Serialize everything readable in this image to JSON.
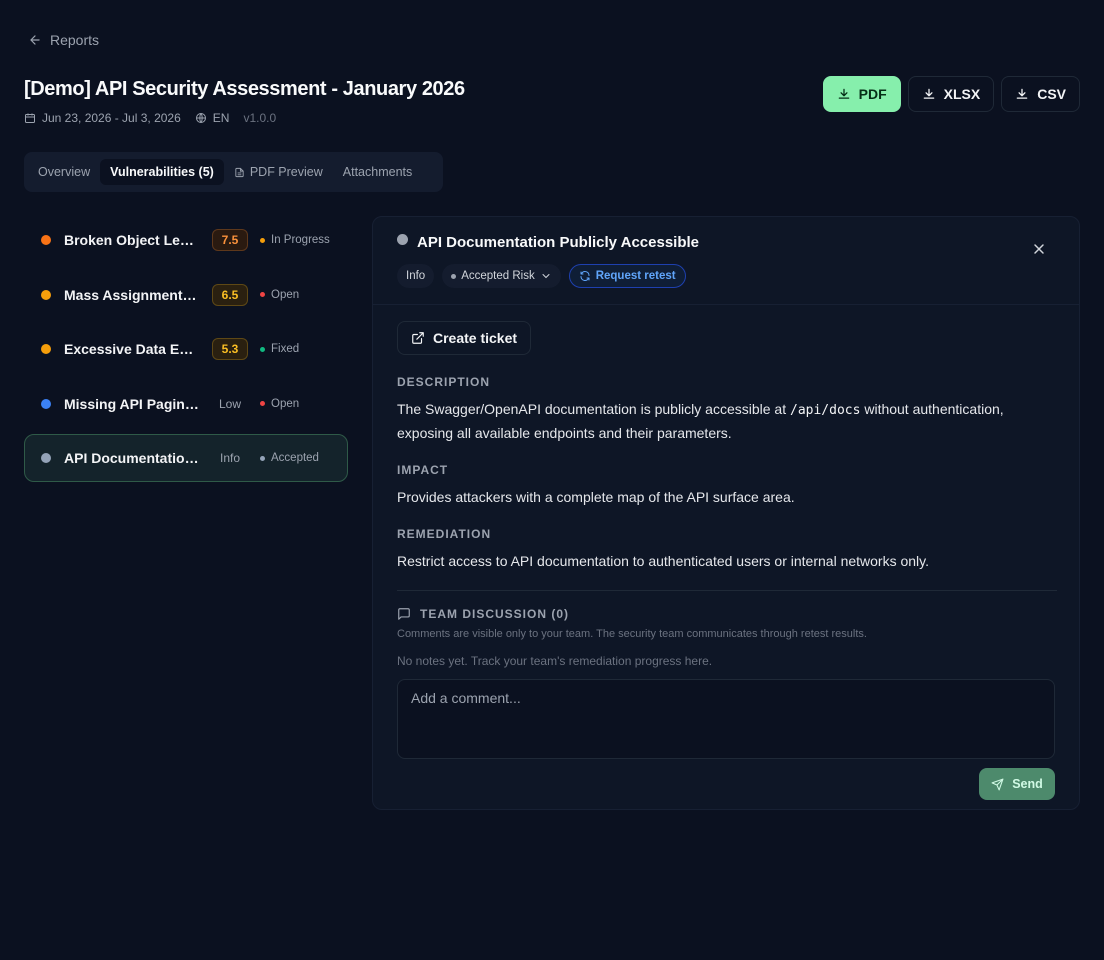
{
  "nav": {
    "back_label": "Reports"
  },
  "report": {
    "title": "[Demo] API Security Assessment - January 2026",
    "date_range": "Jun 23, 2026 - Jul 3, 2026",
    "language": "EN",
    "version": "v1.0.0"
  },
  "exports": [
    {
      "label": "PDF"
    },
    {
      "label": "XLSX"
    },
    {
      "label": "CSV"
    }
  ],
  "tabs": [
    {
      "label": "Overview"
    },
    {
      "label": "Vulnerabilities (5)"
    },
    {
      "label": "PDF Preview"
    },
    {
      "label": "Attachments"
    }
  ],
  "vulnerabilities": [
    {
      "name": "Broken Object Level Authorization",
      "score": "7.5",
      "status": "In Progress",
      "severity_color": "#f97316",
      "score_color": "#fb923c",
      "score_bg": "#2a1a10",
      "status_color": "#f59e0b"
    },
    {
      "name": "Mass Assignment Vulnerability",
      "score": "6.5",
      "status": "Open",
      "severity_color": "#f59e0b",
      "score_color": "#fbbf24",
      "score_bg": "#2a2010",
      "status_color": "#ef4444"
    },
    {
      "name": "Excessive Data Exposure",
      "score": "5.3",
      "status": "Fixed",
      "severity_color": "#f59e0b",
      "score_color": "#fbbf24",
      "score_bg": "#2a2010",
      "status_color": "#10b981"
    },
    {
      "name": "Missing API Pagination",
      "score": "Low",
      "status": "Open",
      "severity_color": "#3b82f6",
      "score_color": "#9ca3af",
      "score_bg": "transparent",
      "status_color": "#ef4444"
    },
    {
      "name": "API Documentation Publicly Accessible",
      "score": "Info",
      "status": "Accepted",
      "severity_color": "#94a3b8",
      "score_color": "#9ca3af",
      "score_bg": "transparent",
      "status_color": "#94a3b8"
    }
  ],
  "detail": {
    "title": "API Documentation Publicly Accessible",
    "severity_label": "Info",
    "status_label": "Accepted Risk",
    "retest_label": "Request retest",
    "ticket_label": "Create ticket",
    "description_label": "DESCRIPTION",
    "description_pre": "The Swagger/OpenAPI documentation is publicly accessible at ",
    "description_code": "/api/docs",
    "description_post": " without authentication, exposing all available endpoints and their parameters.",
    "impact_label": "IMPACT",
    "impact_text": "Provides attackers with a complete map of the API surface area.",
    "remediation_label": "REMEDIATION",
    "remediation_text": "Restrict access to API documentation to authenticated users or internal networks only."
  },
  "discussion": {
    "title": "TEAM DISCUSSION (0)",
    "subtitle": "Comments are visible only to your team. The security team communicates through retest results.",
    "empty_text": "No notes yet. Track your team's remediation progress here.",
    "comment_placeholder": "Add a comment...",
    "send_label": "Send"
  }
}
